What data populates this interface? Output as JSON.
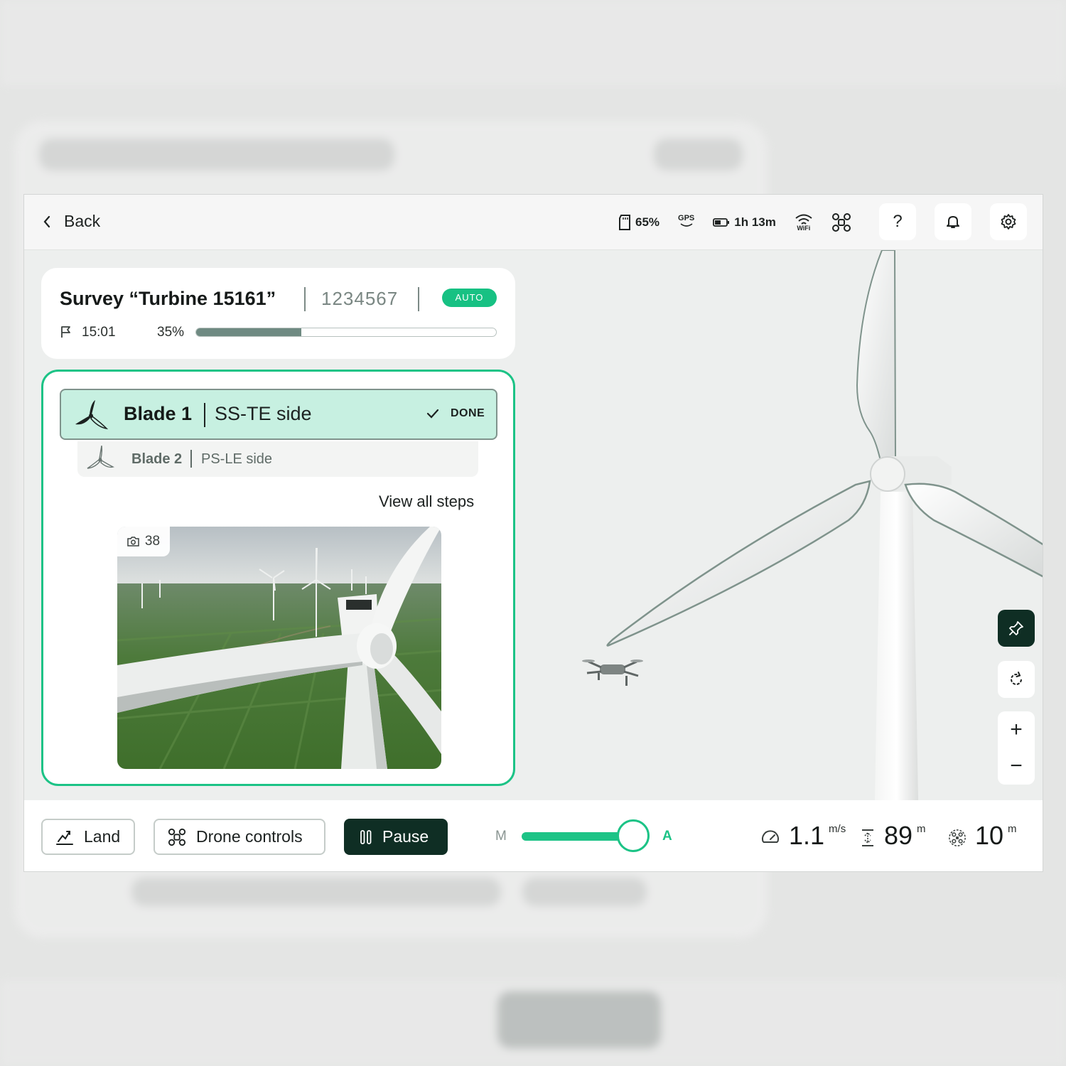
{
  "topbar": {
    "back_label": "Back",
    "storage": "65%",
    "gps": "GPS",
    "battery": "1h 13m",
    "wifi": "WiFi",
    "help": "?"
  },
  "survey": {
    "title": "Survey “Turbine 15161”",
    "id": "1234567",
    "mode_badge": "AUTO",
    "time": "15:01",
    "progress_label": "35%",
    "progress": 0.35
  },
  "steps": {
    "current": {
      "blade": "Blade 1",
      "side": "SS-TE side",
      "status": "DONE"
    },
    "next": {
      "blade": "Blade 2",
      "side": "PS-LE side"
    },
    "view_all": "View all steps",
    "photo_count": "38"
  },
  "view_controls": {
    "zoom_in": "+",
    "zoom_out": "−"
  },
  "bottombar": {
    "land": "Land",
    "drone_controls": "Drone controls",
    "pause": "Pause",
    "mode_manual": "M",
    "mode_auto": "A",
    "speed_value": "1.1",
    "speed_unit": "m/s",
    "altitude_value": "89",
    "altitude_unit": "m",
    "distance_value": "10",
    "distance_unit": "m"
  },
  "colors": {
    "accent": "#1cc386",
    "dark": "#0f2e24",
    "step_bg": "#c7f0e1",
    "progress_fill": "#6f8a82"
  }
}
